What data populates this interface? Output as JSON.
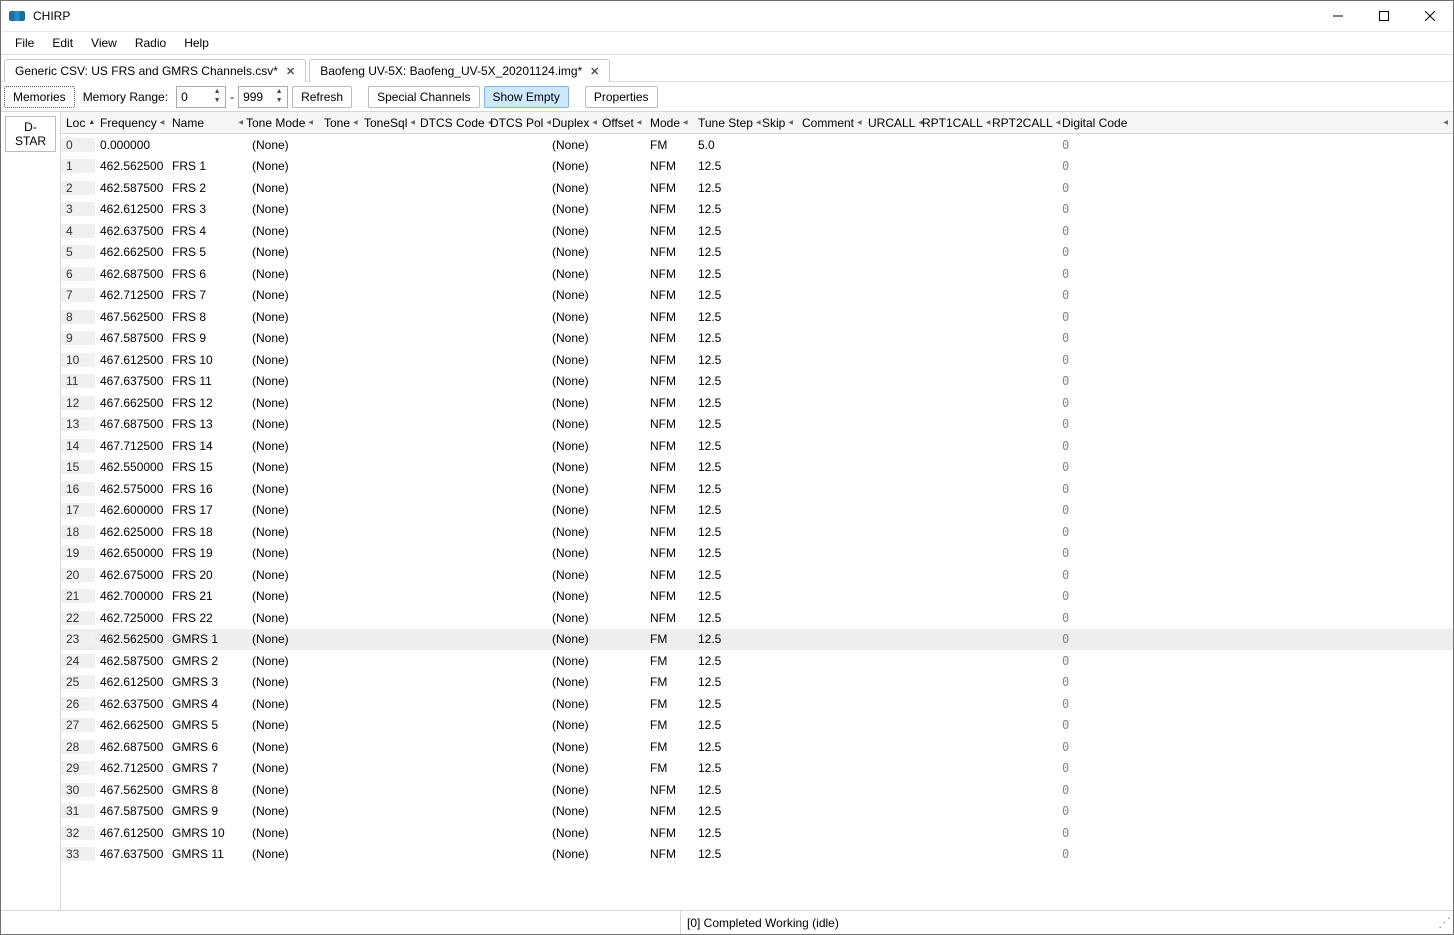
{
  "title": "CHIRP",
  "menu": [
    "File",
    "Edit",
    "View",
    "Radio",
    "Help"
  ],
  "tabs": [
    {
      "label": "Generic CSV: US FRS and GMRS Channels.csv*",
      "active": true
    },
    {
      "label": "Baofeng UV-5X: Baofeng_UV-5X_20201124.img*",
      "active": false
    }
  ],
  "toolbar": {
    "memories": "Memories",
    "memory_range_label": "Memory Range:",
    "range_from": "0",
    "range_dash": "-",
    "range_to": "999",
    "refresh": "Refresh",
    "special": "Special Channels",
    "show_empty": "Show Empty",
    "properties": "Properties"
  },
  "sidebar": {
    "dstar": "D-STAR"
  },
  "columns": [
    "Loc",
    "Frequency",
    "Name",
    "Tone Mode",
    "Tone",
    "ToneSql",
    "DTCS Code",
    "DTCS Pol",
    "Duplex",
    "Offset",
    "Mode",
    "Tune Step",
    "Skip",
    "Comment",
    "URCALL",
    "RPT1CALL",
    "RPT2CALL",
    "Digital Code"
  ],
  "rows": [
    {
      "loc": "0",
      "freq": "0.000000",
      "name": "",
      "tonemode": "(None)",
      "duplex": "(None)",
      "mode": "FM",
      "tunestep": "5.0",
      "digital": "0"
    },
    {
      "loc": "1",
      "freq": "462.562500",
      "name": "FRS 1",
      "tonemode": "(None)",
      "duplex": "(None)",
      "mode": "NFM",
      "tunestep": "12.5",
      "digital": "0"
    },
    {
      "loc": "2",
      "freq": "462.587500",
      "name": "FRS 2",
      "tonemode": "(None)",
      "duplex": "(None)",
      "mode": "NFM",
      "tunestep": "12.5",
      "digital": "0"
    },
    {
      "loc": "3",
      "freq": "462.612500",
      "name": "FRS 3",
      "tonemode": "(None)",
      "duplex": "(None)",
      "mode": "NFM",
      "tunestep": "12.5",
      "digital": "0"
    },
    {
      "loc": "4",
      "freq": "462.637500",
      "name": "FRS 4",
      "tonemode": "(None)",
      "duplex": "(None)",
      "mode": "NFM",
      "tunestep": "12.5",
      "digital": "0"
    },
    {
      "loc": "5",
      "freq": "462.662500",
      "name": "FRS 5",
      "tonemode": "(None)",
      "duplex": "(None)",
      "mode": "NFM",
      "tunestep": "12.5",
      "digital": "0"
    },
    {
      "loc": "6",
      "freq": "462.687500",
      "name": "FRS 6",
      "tonemode": "(None)",
      "duplex": "(None)",
      "mode": "NFM",
      "tunestep": "12.5",
      "digital": "0"
    },
    {
      "loc": "7",
      "freq": "462.712500",
      "name": "FRS 7",
      "tonemode": "(None)",
      "duplex": "(None)",
      "mode": "NFM",
      "tunestep": "12.5",
      "digital": "0"
    },
    {
      "loc": "8",
      "freq": "467.562500",
      "name": "FRS 8",
      "tonemode": "(None)",
      "duplex": "(None)",
      "mode": "NFM",
      "tunestep": "12.5",
      "digital": "0"
    },
    {
      "loc": "9",
      "freq": "467.587500",
      "name": "FRS 9",
      "tonemode": "(None)",
      "duplex": "(None)",
      "mode": "NFM",
      "tunestep": "12.5",
      "digital": "0"
    },
    {
      "loc": "10",
      "freq": "467.612500",
      "name": "FRS 10",
      "tonemode": "(None)",
      "duplex": "(None)",
      "mode": "NFM",
      "tunestep": "12.5",
      "digital": "0"
    },
    {
      "loc": "11",
      "freq": "467.637500",
      "name": "FRS 11",
      "tonemode": "(None)",
      "duplex": "(None)",
      "mode": "NFM",
      "tunestep": "12.5",
      "digital": "0"
    },
    {
      "loc": "12",
      "freq": "467.662500",
      "name": "FRS 12",
      "tonemode": "(None)",
      "duplex": "(None)",
      "mode": "NFM",
      "tunestep": "12.5",
      "digital": "0"
    },
    {
      "loc": "13",
      "freq": "467.687500",
      "name": "FRS 13",
      "tonemode": "(None)",
      "duplex": "(None)",
      "mode": "NFM",
      "tunestep": "12.5",
      "digital": "0"
    },
    {
      "loc": "14",
      "freq": "467.712500",
      "name": "FRS 14",
      "tonemode": "(None)",
      "duplex": "(None)",
      "mode": "NFM",
      "tunestep": "12.5",
      "digital": "0"
    },
    {
      "loc": "15",
      "freq": "462.550000",
      "name": "FRS 15",
      "tonemode": "(None)",
      "duplex": "(None)",
      "mode": "NFM",
      "tunestep": "12.5",
      "digital": "0"
    },
    {
      "loc": "16",
      "freq": "462.575000",
      "name": "FRS 16",
      "tonemode": "(None)",
      "duplex": "(None)",
      "mode": "NFM",
      "tunestep": "12.5",
      "digital": "0"
    },
    {
      "loc": "17",
      "freq": "462.600000",
      "name": "FRS 17",
      "tonemode": "(None)",
      "duplex": "(None)",
      "mode": "NFM",
      "tunestep": "12.5",
      "digital": "0"
    },
    {
      "loc": "18",
      "freq": "462.625000",
      "name": "FRS 18",
      "tonemode": "(None)",
      "duplex": "(None)",
      "mode": "NFM",
      "tunestep": "12.5",
      "digital": "0"
    },
    {
      "loc": "19",
      "freq": "462.650000",
      "name": "FRS 19",
      "tonemode": "(None)",
      "duplex": "(None)",
      "mode": "NFM",
      "tunestep": "12.5",
      "digital": "0"
    },
    {
      "loc": "20",
      "freq": "462.675000",
      "name": "FRS 20",
      "tonemode": "(None)",
      "duplex": "(None)",
      "mode": "NFM",
      "tunestep": "12.5",
      "digital": "0"
    },
    {
      "loc": "21",
      "freq": "462.700000",
      "name": "FRS 21",
      "tonemode": "(None)",
      "duplex": "(None)",
      "mode": "NFM",
      "tunestep": "12.5",
      "digital": "0"
    },
    {
      "loc": "22",
      "freq": "462.725000",
      "name": "FRS 22",
      "tonemode": "(None)",
      "duplex": "(None)",
      "mode": "NFM",
      "tunestep": "12.5",
      "digital": "0"
    },
    {
      "loc": "23",
      "freq": "462.562500",
      "name": "GMRS 1",
      "tonemode": "(None)",
      "duplex": "(None)",
      "mode": "FM",
      "tunestep": "12.5",
      "digital": "0",
      "sel": true
    },
    {
      "loc": "24",
      "freq": "462.587500",
      "name": "GMRS 2",
      "tonemode": "(None)",
      "duplex": "(None)",
      "mode": "FM",
      "tunestep": "12.5",
      "digital": "0"
    },
    {
      "loc": "25",
      "freq": "462.612500",
      "name": "GMRS 3",
      "tonemode": "(None)",
      "duplex": "(None)",
      "mode": "FM",
      "tunestep": "12.5",
      "digital": "0"
    },
    {
      "loc": "26",
      "freq": "462.637500",
      "name": "GMRS 4",
      "tonemode": "(None)",
      "duplex": "(None)",
      "mode": "FM",
      "tunestep": "12.5",
      "digital": "0"
    },
    {
      "loc": "27",
      "freq": "462.662500",
      "name": "GMRS 5",
      "tonemode": "(None)",
      "duplex": "(None)",
      "mode": "FM",
      "tunestep": "12.5",
      "digital": "0"
    },
    {
      "loc": "28",
      "freq": "462.687500",
      "name": "GMRS 6",
      "tonemode": "(None)",
      "duplex": "(None)",
      "mode": "FM",
      "tunestep": "12.5",
      "digital": "0"
    },
    {
      "loc": "29",
      "freq": "462.712500",
      "name": "GMRS 7",
      "tonemode": "(None)",
      "duplex": "(None)",
      "mode": "FM",
      "tunestep": "12.5",
      "digital": "0"
    },
    {
      "loc": "30",
      "freq": "467.562500",
      "name": "GMRS 8",
      "tonemode": "(None)",
      "duplex": "(None)",
      "mode": "NFM",
      "tunestep": "12.5",
      "digital": "0"
    },
    {
      "loc": "31",
      "freq": "467.587500",
      "name": "GMRS 9",
      "tonemode": "(None)",
      "duplex": "(None)",
      "mode": "NFM",
      "tunestep": "12.5",
      "digital": "0"
    },
    {
      "loc": "32",
      "freq": "467.612500",
      "name": "GMRS 10",
      "tonemode": "(None)",
      "duplex": "(None)",
      "mode": "NFM",
      "tunestep": "12.5",
      "digital": "0"
    },
    {
      "loc": "33",
      "freq": "467.637500",
      "name": "GMRS 11",
      "tonemode": "(None)",
      "duplex": "(None)",
      "mode": "NFM",
      "tunestep": "12.5",
      "digital": "0"
    }
  ],
  "status": "[0] Completed Working (idle)"
}
